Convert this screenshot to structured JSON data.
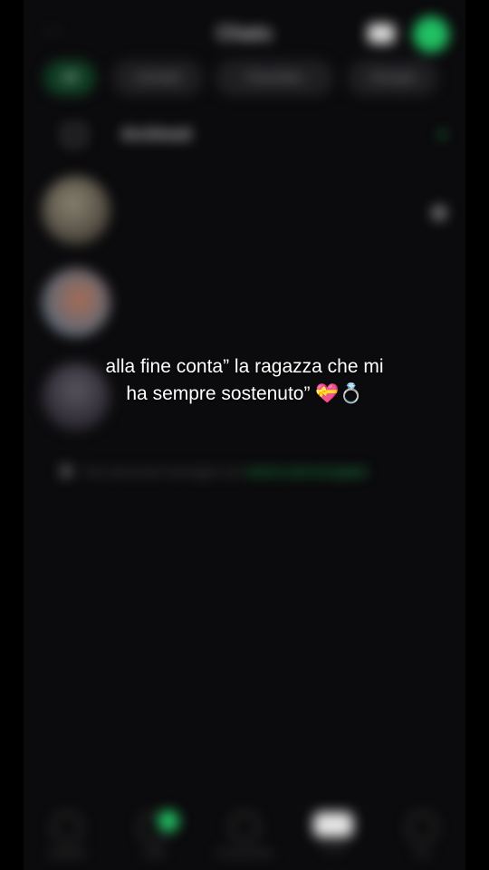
{
  "header": {
    "title": "Chats",
    "menu_icon": "menu-icon",
    "camera_icon": "camera-icon",
    "new_chat_icon": "new-chat-icon"
  },
  "filters": [
    "All",
    "Unread",
    "Favorites",
    "Groups"
  ],
  "archived": {
    "label": "Archived",
    "count": "4"
  },
  "chats": [
    {
      "name": "",
      "preview": "",
      "time": "",
      "pinned": true
    },
    {
      "name": "",
      "preview": "",
      "time": "",
      "pinned": false
    },
    {
      "name": "",
      "preview": "",
      "time": "",
      "pinned": false
    }
  ],
  "encryption": {
    "text": "Your personal messages are",
    "link": "end-to-end encrypted"
  },
  "bottom_nav": [
    {
      "label": "Updates"
    },
    {
      "label": "Calls"
    },
    {
      "label": "Communities"
    },
    {
      "label": "Chats"
    },
    {
      "label": "You"
    }
  ],
  "caption": {
    "line1": "alla fine conta” la ragazza che mi",
    "line2": "ha sempre sostenuto” 💝💍"
  },
  "colors": {
    "accent": "#21c063",
    "background": "#0b0a0c",
    "caption": "#ffffff"
  }
}
